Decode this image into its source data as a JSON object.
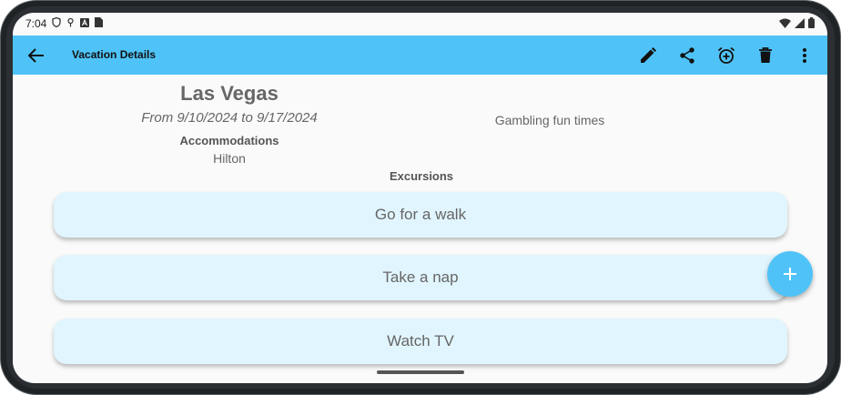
{
  "status_bar": {
    "time": "7:04",
    "left_icons": [
      "shield-icon",
      "vpn-icon",
      "app-a-icon",
      "sim-card-icon"
    ],
    "right_icons": [
      "wifi-icon",
      "signal-icon",
      "battery-icon"
    ]
  },
  "app_bar": {
    "title": "Vacation Details",
    "back_icon": "arrow-back-icon",
    "actions": [
      "edit-icon",
      "share-icon",
      "alarm-add-icon",
      "delete-icon",
      "more-vert-icon"
    ]
  },
  "vacation": {
    "title": "Las Vegas",
    "dates": "From 9/10/2024 to 9/17/2024",
    "accommodations_label": "Accommodations",
    "accommodations_value": "Hilton",
    "notes": "Gambling fun times"
  },
  "excursions": {
    "label": "Excursions",
    "items": [
      "Go for a walk",
      "Take a nap",
      "Watch TV"
    ]
  },
  "fab": {
    "icon": "add-icon"
  },
  "colors": {
    "app_bar": "#4fc3f7",
    "card": "#e1f5fe",
    "fab": "#4fc3f7",
    "background": "#fafafa"
  }
}
